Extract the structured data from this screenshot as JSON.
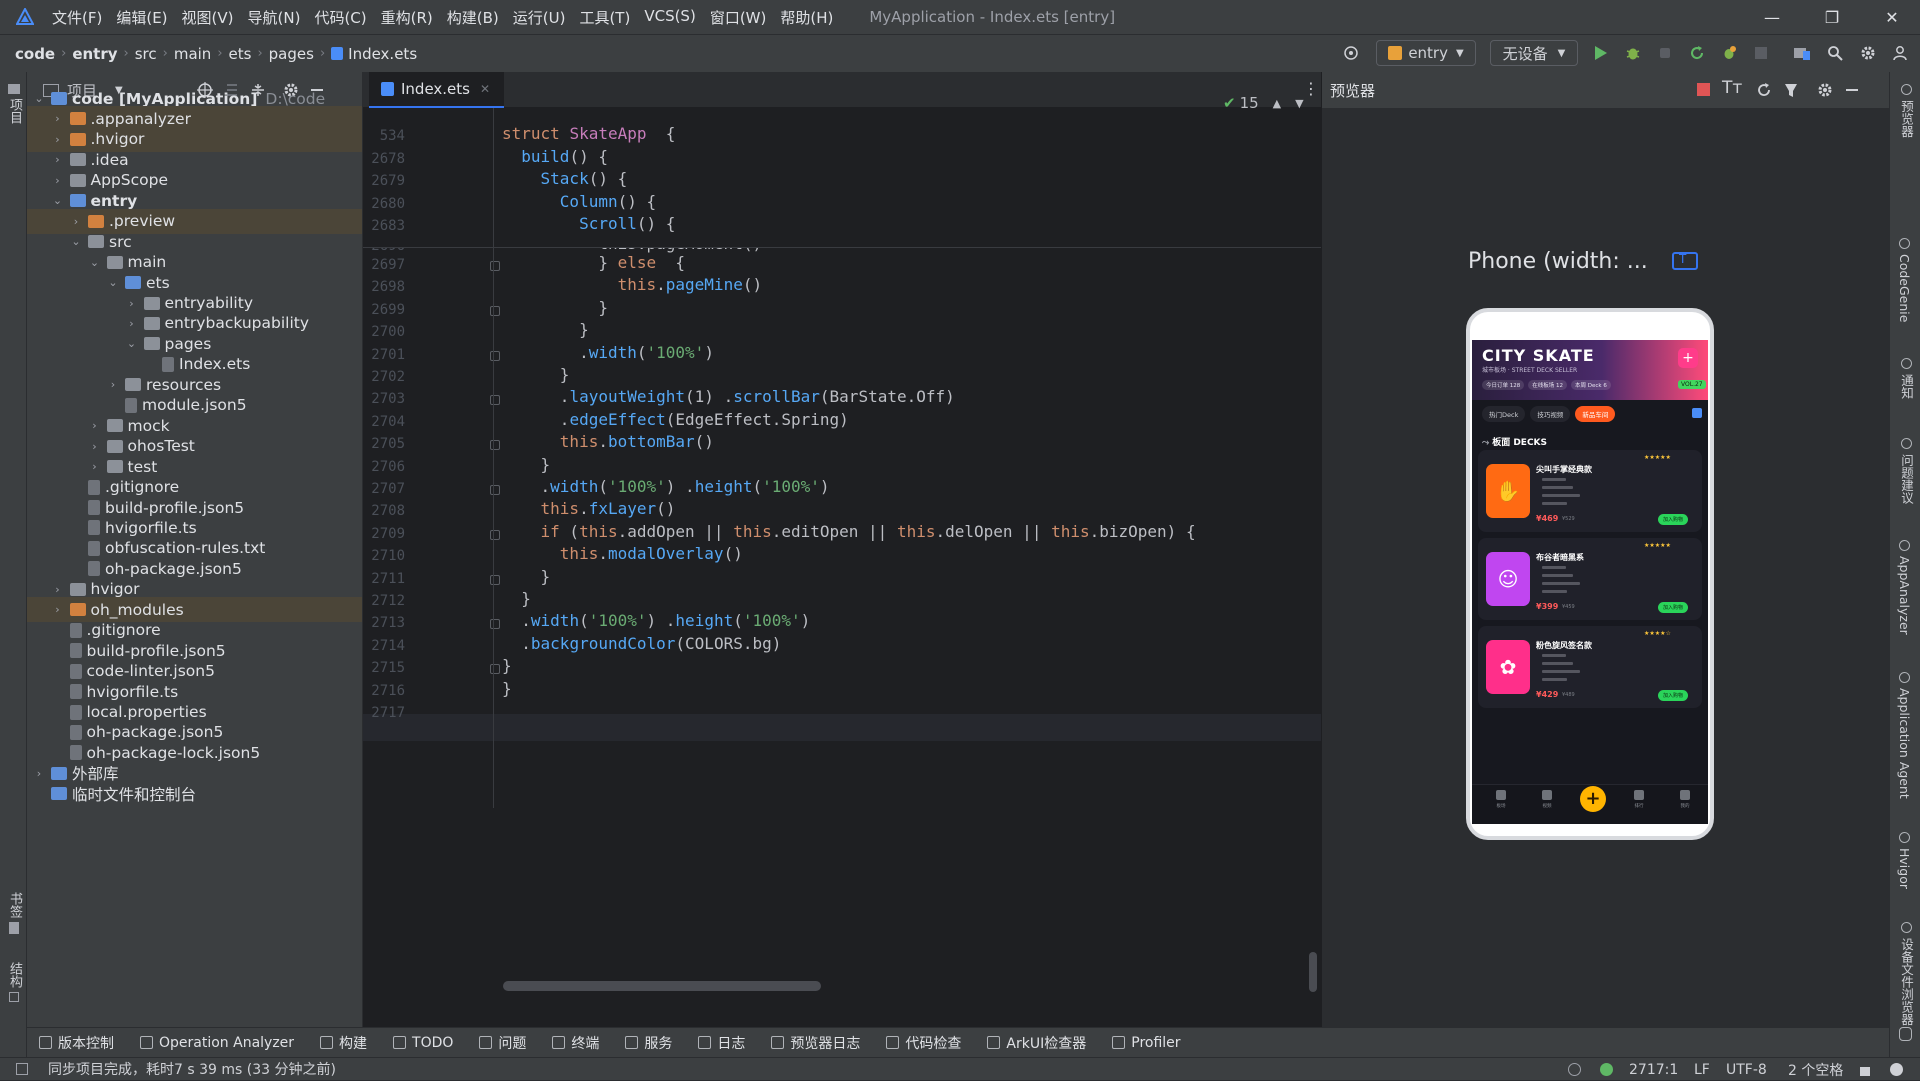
{
  "menubar": {
    "menus": [
      "文件(F)",
      "编辑(E)",
      "视图(V)",
      "导航(N)",
      "代码(C)",
      "重构(R)",
      "构建(B)",
      "运行(U)",
      "工具(T)",
      "VCS(S)",
      "窗口(W)",
      "帮助(H)"
    ],
    "window_title": "MyApplication - Index.ets [entry]",
    "minimize": "—",
    "maximize": "❐",
    "close": "✕"
  },
  "navbar": {
    "crumbs": [
      "code",
      "entry",
      "src",
      "main",
      "ets",
      "pages",
      "Index.ets"
    ],
    "run_config": "entry",
    "device": "无设备"
  },
  "left_strip": {
    "project": "项目",
    "bookmarks": "书签",
    "structure": "结构"
  },
  "project_panel": {
    "title": "项目",
    "tree": [
      {
        "label": "code [MyApplication]",
        "path": "D:\\code",
        "depth": 0,
        "arrow": "down",
        "icon": "folder-blue",
        "excluded": false
      },
      {
        "label": ".appanalyzer",
        "depth": 1,
        "arrow": "right",
        "icon": "folder-orange",
        "excluded": true
      },
      {
        "label": ".hvigor",
        "depth": 1,
        "arrow": "right",
        "icon": "folder-orange",
        "excluded": true
      },
      {
        "label": ".idea",
        "depth": 1,
        "arrow": "right",
        "icon": "folder",
        "excluded": false
      },
      {
        "label": "AppScope",
        "depth": 1,
        "arrow": "right",
        "icon": "folder",
        "excluded": false
      },
      {
        "label": "entry",
        "depth": 1,
        "arrow": "down",
        "icon": "folder-blue",
        "excluded": false
      },
      {
        "label": ".preview",
        "depth": 2,
        "arrow": "right",
        "icon": "folder-orange",
        "excluded": true
      },
      {
        "label": "src",
        "depth": 2,
        "arrow": "down",
        "icon": "folder",
        "excluded": false
      },
      {
        "label": "main",
        "depth": 3,
        "arrow": "down",
        "icon": "folder",
        "excluded": false
      },
      {
        "label": "ets",
        "depth": 4,
        "arrow": "down",
        "icon": "folder-blue",
        "excluded": false
      },
      {
        "label": "entryability",
        "depth": 5,
        "arrow": "right",
        "icon": "folder",
        "excluded": false
      },
      {
        "label": "entrybackupability",
        "depth": 5,
        "arrow": "right",
        "icon": "folder",
        "excluded": false
      },
      {
        "label": "pages",
        "depth": 5,
        "arrow": "down",
        "icon": "folder",
        "excluded": false
      },
      {
        "label": "Index.ets",
        "depth": 6,
        "arrow": "",
        "icon": "file",
        "excluded": false
      },
      {
        "label": "resources",
        "depth": 4,
        "arrow": "right",
        "icon": "folder",
        "excluded": false
      },
      {
        "label": "module.json5",
        "depth": 4,
        "arrow": "",
        "icon": "file",
        "excluded": false
      },
      {
        "label": "mock",
        "depth": 3,
        "arrow": "right",
        "icon": "folder",
        "excluded": false
      },
      {
        "label": "ohosTest",
        "depth": 3,
        "arrow": "right",
        "icon": "folder",
        "excluded": false
      },
      {
        "label": "test",
        "depth": 3,
        "arrow": "right",
        "icon": "folder",
        "excluded": false
      },
      {
        "label": ".gitignore",
        "depth": 2,
        "arrow": "",
        "icon": "file",
        "excluded": false
      },
      {
        "label": "build-profile.json5",
        "depth": 2,
        "arrow": "",
        "icon": "file",
        "excluded": false
      },
      {
        "label": "hvigorfile.ts",
        "depth": 2,
        "arrow": "",
        "icon": "file",
        "excluded": false
      },
      {
        "label": "obfuscation-rules.txt",
        "depth": 2,
        "arrow": "",
        "icon": "file",
        "excluded": false
      },
      {
        "label": "oh-package.json5",
        "depth": 2,
        "arrow": "",
        "icon": "file",
        "excluded": false
      },
      {
        "label": "hvigor",
        "depth": 1,
        "arrow": "right",
        "icon": "folder",
        "excluded": false
      },
      {
        "label": "oh_modules",
        "depth": 1,
        "arrow": "right",
        "icon": "folder-orange",
        "excluded": true
      },
      {
        "label": ".gitignore",
        "depth": 1,
        "arrow": "",
        "icon": "file",
        "excluded": false
      },
      {
        "label": "build-profile.json5",
        "depth": 1,
        "arrow": "",
        "icon": "file",
        "excluded": false
      },
      {
        "label": "code-linter.json5",
        "depth": 1,
        "arrow": "",
        "icon": "file",
        "excluded": false
      },
      {
        "label": "hvigorfile.ts",
        "depth": 1,
        "arrow": "",
        "icon": "file",
        "excluded": false
      },
      {
        "label": "local.properties",
        "depth": 1,
        "arrow": "",
        "icon": "file",
        "excluded": false
      },
      {
        "label": "oh-package.json5",
        "depth": 1,
        "arrow": "",
        "icon": "file",
        "excluded": false
      },
      {
        "label": "oh-package-lock.json5",
        "depth": 1,
        "arrow": "",
        "icon": "file",
        "excluded": false
      },
      {
        "label": "外部库",
        "depth": 0,
        "arrow": "right",
        "icon": "library",
        "excluded": false
      },
      {
        "label": "临时文件和控制台",
        "depth": 0,
        "arrow": "",
        "icon": "scratch",
        "excluded": false
      }
    ]
  },
  "editor": {
    "tab": "Index.ets",
    "inspection_count": "15",
    "sticky_lines": [
      {
        "ln": "534",
        "html": [
          [
            "kw",
            "struct "
          ],
          [
            "cls",
            "SkateApp"
          ],
          [
            "",
            "  {"
          ]
        ]
      },
      {
        "ln": "2678",
        "html": [
          [
            "",
            "  "
          ],
          [
            "fn",
            "build"
          ],
          [
            "",
            "() {"
          ]
        ]
      },
      {
        "ln": "2679",
        "html": [
          [
            "",
            "    "
          ],
          [
            "fn",
            "Stack"
          ],
          [
            "",
            "() {"
          ]
        ]
      },
      {
        "ln": "2680",
        "html": [
          [
            "",
            "      "
          ],
          [
            "fn",
            "Column"
          ],
          [
            "",
            "() {"
          ]
        ]
      },
      {
        "ln": "2683",
        "html": [
          [
            "",
            "        "
          ],
          [
            "fn",
            "Scroll"
          ],
          [
            "",
            "() {"
          ]
        ]
      }
    ],
    "partial_line": {
      "ln": "2696",
      "text": "          this.pageMoment()"
    },
    "lines": [
      {
        "ln": "2697",
        "html": [
          [
            "",
            "          } "
          ],
          [
            "kw",
            "else"
          ],
          [
            "",
            "  {"
          ]
        ]
      },
      {
        "ln": "2698",
        "html": [
          [
            "",
            "            "
          ],
          [
            "kw",
            "this"
          ],
          [
            "",
            "."
          ],
          [
            "fn",
            "pageMine"
          ],
          [
            "",
            "()"
          ]
        ]
      },
      {
        "ln": "2699",
        "html": [
          [
            "",
            "          }"
          ]
        ]
      },
      {
        "ln": "2700",
        "html": [
          [
            "",
            "        }"
          ]
        ]
      },
      {
        "ln": "2701",
        "html": [
          [
            "",
            "        ."
          ],
          [
            "fn",
            "width"
          ],
          [
            "",
            "("
          ],
          [
            "str",
            "'100%'"
          ],
          [
            "",
            ")"
          ]
        ]
      },
      {
        "ln": "2702",
        "html": [
          [
            "",
            "      }"
          ]
        ]
      },
      {
        "ln": "2703",
        "html": [
          [
            "",
            "      ."
          ],
          [
            "fn",
            "layoutWeight"
          ],
          [
            "",
            "(1) ."
          ],
          [
            "fn",
            "scrollBar"
          ],
          [
            "",
            "(BarState.Off)"
          ]
        ]
      },
      {
        "ln": "2704",
        "html": [
          [
            "",
            "      ."
          ],
          [
            "fn",
            "edgeEffect"
          ],
          [
            "",
            "(EdgeEffect.Spring)"
          ]
        ]
      },
      {
        "ln": "2705",
        "html": [
          [
            "",
            "      "
          ],
          [
            "kw",
            "this"
          ],
          [
            "",
            "."
          ],
          [
            "fn",
            "bottomBar"
          ],
          [
            "",
            "()"
          ]
        ]
      },
      {
        "ln": "2706",
        "html": [
          [
            "",
            "    }"
          ]
        ]
      },
      {
        "ln": "2707",
        "html": [
          [
            "",
            "    ."
          ],
          [
            "fn",
            "width"
          ],
          [
            "",
            "("
          ],
          [
            "str",
            "'100%'"
          ],
          [
            "",
            ") ."
          ],
          [
            "fn",
            "height"
          ],
          [
            "",
            "("
          ],
          [
            "str",
            "'100%'"
          ],
          [
            "",
            ")"
          ]
        ]
      },
      {
        "ln": "2708",
        "html": [
          [
            "",
            "    "
          ],
          [
            "kw",
            "this"
          ],
          [
            "",
            "."
          ],
          [
            "fn",
            "fxLayer"
          ],
          [
            "",
            "()"
          ]
        ]
      },
      {
        "ln": "2709",
        "html": [
          [
            "",
            "    "
          ],
          [
            "kw",
            "if"
          ],
          [
            "",
            " ("
          ],
          [
            "kw",
            "this"
          ],
          [
            "",
            ".addOpen || "
          ],
          [
            "kw",
            "this"
          ],
          [
            "",
            ".editOpen || "
          ],
          [
            "kw",
            "this"
          ],
          [
            "",
            ".delOpen || "
          ],
          [
            "kw",
            "this"
          ],
          [
            "",
            ".bizOpen) {"
          ]
        ]
      },
      {
        "ln": "2710",
        "html": [
          [
            "",
            "      "
          ],
          [
            "kw",
            "this"
          ],
          [
            "",
            "."
          ],
          [
            "fn",
            "modalOverlay"
          ],
          [
            "",
            "()"
          ]
        ]
      },
      {
        "ln": "2711",
        "html": [
          [
            "",
            "    }"
          ]
        ]
      },
      {
        "ln": "2712",
        "html": [
          [
            "",
            "  }"
          ]
        ]
      },
      {
        "ln": "2713",
        "html": [
          [
            "",
            "  ."
          ],
          [
            "fn",
            "width"
          ],
          [
            "",
            "("
          ],
          [
            "str",
            "'100%'"
          ],
          [
            "",
            ") ."
          ],
          [
            "fn",
            "height"
          ],
          [
            "",
            "("
          ],
          [
            "str",
            "'100%'"
          ],
          [
            "",
            ")"
          ]
        ]
      },
      {
        "ln": "2714",
        "html": [
          [
            "",
            "  ."
          ],
          [
            "fn",
            "backgroundColor"
          ],
          [
            "",
            "(COLORS.bg)"
          ]
        ]
      },
      {
        "ln": "2715",
        "html": [
          [
            "",
            "}"
          ]
        ]
      },
      {
        "ln": "2716",
        "html": [
          [
            "",
            "}"
          ]
        ]
      },
      {
        "ln": "2717",
        "html": [
          [
            "",
            ""
          ]
        ]
      }
    ]
  },
  "preview": {
    "title": "预览器",
    "device_label": "Phone (width: ...",
    "app": {
      "brand": "CITY SKATE",
      "tagline": "城市板场 · STREET DECK SELLER",
      "stats": [
        "今日订单 128",
        "在线板场 12",
        "本周 Deck 6"
      ],
      "vol": "VOL.27",
      "chips": [
        "热门Deck",
        "技巧视频",
        "新品车间"
      ],
      "section": "板面 DECKS",
      "products": [
        {
          "name": "尖叫手掌经典款",
          "price": "¥469",
          "old": "¥529",
          "stars": "★★★★★",
          "color": "#ff6a13",
          "glyph": "✋"
        },
        {
          "name": "布谷者暗黑系",
          "price": "¥399",
          "old": "¥459",
          "stars": "★★★★★",
          "color": "#c046f0",
          "glyph": "☺"
        },
        {
          "name": "粉色旋风签名款",
          "price": "¥429",
          "old": "¥489",
          "stars": "★★★★☆",
          "color": "#ff2f8a",
          "glyph": "✿"
        }
      ],
      "add_label": "加入购物",
      "tabs": [
        "板场",
        "视频",
        "",
        "排行",
        "我的"
      ]
    }
  },
  "right_strip": [
    "预览器",
    "CodeGenie",
    "通知",
    "问题建议",
    "AppAnalyzer",
    "Application Agent",
    "Hvigor",
    "设备文件浏览器"
  ],
  "bottom_tools": [
    "版本控制",
    "Operation Analyzer",
    "构建",
    "TODO",
    "问题",
    "终端",
    "服务",
    "日志",
    "预览器日志",
    "代码检查",
    "ArkUI检查器",
    "Profiler"
  ],
  "status": {
    "message": "同步项目完成，耗时7 s 39 ms (33 分钟之前)",
    "position": "2717:1",
    "line_sep": "LF",
    "encoding": "UTF-8",
    "indent": "2 个空格"
  },
  "colors": {
    "accent": "#3574f0",
    "run": "#5fb865",
    "debug": "#7fb14a",
    "stop": "#e05555"
  }
}
